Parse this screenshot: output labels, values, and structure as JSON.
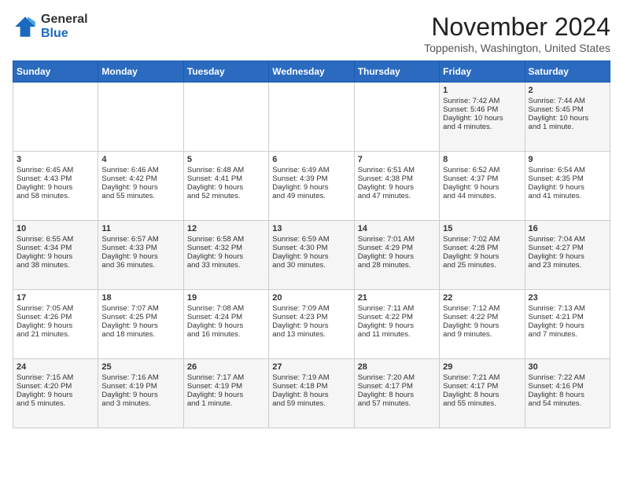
{
  "logo": {
    "general": "General",
    "blue": "Blue"
  },
  "title": "November 2024",
  "location": "Toppenish, Washington, United States",
  "days_of_week": [
    "Sunday",
    "Monday",
    "Tuesday",
    "Wednesday",
    "Thursday",
    "Friday",
    "Saturday"
  ],
  "weeks": [
    [
      {
        "day": "",
        "info": ""
      },
      {
        "day": "",
        "info": ""
      },
      {
        "day": "",
        "info": ""
      },
      {
        "day": "",
        "info": ""
      },
      {
        "day": "",
        "info": ""
      },
      {
        "day": "1",
        "info": "Sunrise: 7:42 AM\nSunset: 5:46 PM\nDaylight: 10 hours\nand 4 minutes."
      },
      {
        "day": "2",
        "info": "Sunrise: 7:44 AM\nSunset: 5:45 PM\nDaylight: 10 hours\nand 1 minute."
      }
    ],
    [
      {
        "day": "3",
        "info": "Sunrise: 6:45 AM\nSunset: 4:43 PM\nDaylight: 9 hours\nand 58 minutes."
      },
      {
        "day": "4",
        "info": "Sunrise: 6:46 AM\nSunset: 4:42 PM\nDaylight: 9 hours\nand 55 minutes."
      },
      {
        "day": "5",
        "info": "Sunrise: 6:48 AM\nSunset: 4:41 PM\nDaylight: 9 hours\nand 52 minutes."
      },
      {
        "day": "6",
        "info": "Sunrise: 6:49 AM\nSunset: 4:39 PM\nDaylight: 9 hours\nand 49 minutes."
      },
      {
        "day": "7",
        "info": "Sunrise: 6:51 AM\nSunset: 4:38 PM\nDaylight: 9 hours\nand 47 minutes."
      },
      {
        "day": "8",
        "info": "Sunrise: 6:52 AM\nSunset: 4:37 PM\nDaylight: 9 hours\nand 44 minutes."
      },
      {
        "day": "9",
        "info": "Sunrise: 6:54 AM\nSunset: 4:35 PM\nDaylight: 9 hours\nand 41 minutes."
      }
    ],
    [
      {
        "day": "10",
        "info": "Sunrise: 6:55 AM\nSunset: 4:34 PM\nDaylight: 9 hours\nand 38 minutes."
      },
      {
        "day": "11",
        "info": "Sunrise: 6:57 AM\nSunset: 4:33 PM\nDaylight: 9 hours\nand 36 minutes."
      },
      {
        "day": "12",
        "info": "Sunrise: 6:58 AM\nSunset: 4:32 PM\nDaylight: 9 hours\nand 33 minutes."
      },
      {
        "day": "13",
        "info": "Sunrise: 6:59 AM\nSunset: 4:30 PM\nDaylight: 9 hours\nand 30 minutes."
      },
      {
        "day": "14",
        "info": "Sunrise: 7:01 AM\nSunset: 4:29 PM\nDaylight: 9 hours\nand 28 minutes."
      },
      {
        "day": "15",
        "info": "Sunrise: 7:02 AM\nSunset: 4:28 PM\nDaylight: 9 hours\nand 25 minutes."
      },
      {
        "day": "16",
        "info": "Sunrise: 7:04 AM\nSunset: 4:27 PM\nDaylight: 9 hours\nand 23 minutes."
      }
    ],
    [
      {
        "day": "17",
        "info": "Sunrise: 7:05 AM\nSunset: 4:26 PM\nDaylight: 9 hours\nand 21 minutes."
      },
      {
        "day": "18",
        "info": "Sunrise: 7:07 AM\nSunset: 4:25 PM\nDaylight: 9 hours\nand 18 minutes."
      },
      {
        "day": "19",
        "info": "Sunrise: 7:08 AM\nSunset: 4:24 PM\nDaylight: 9 hours\nand 16 minutes."
      },
      {
        "day": "20",
        "info": "Sunrise: 7:09 AM\nSunset: 4:23 PM\nDaylight: 9 hours\nand 13 minutes."
      },
      {
        "day": "21",
        "info": "Sunrise: 7:11 AM\nSunset: 4:22 PM\nDaylight: 9 hours\nand 11 minutes."
      },
      {
        "day": "22",
        "info": "Sunrise: 7:12 AM\nSunset: 4:22 PM\nDaylight: 9 hours\nand 9 minutes."
      },
      {
        "day": "23",
        "info": "Sunrise: 7:13 AM\nSunset: 4:21 PM\nDaylight: 9 hours\nand 7 minutes."
      }
    ],
    [
      {
        "day": "24",
        "info": "Sunrise: 7:15 AM\nSunset: 4:20 PM\nDaylight: 9 hours\nand 5 minutes."
      },
      {
        "day": "25",
        "info": "Sunrise: 7:16 AM\nSunset: 4:19 PM\nDaylight: 9 hours\nand 3 minutes."
      },
      {
        "day": "26",
        "info": "Sunrise: 7:17 AM\nSunset: 4:19 PM\nDaylight: 9 hours\nand 1 minute."
      },
      {
        "day": "27",
        "info": "Sunrise: 7:19 AM\nSunset: 4:18 PM\nDaylight: 8 hours\nand 59 minutes."
      },
      {
        "day": "28",
        "info": "Sunrise: 7:20 AM\nSunset: 4:17 PM\nDaylight: 8 hours\nand 57 minutes."
      },
      {
        "day": "29",
        "info": "Sunrise: 7:21 AM\nSunset: 4:17 PM\nDaylight: 8 hours\nand 55 minutes."
      },
      {
        "day": "30",
        "info": "Sunrise: 7:22 AM\nSunset: 4:16 PM\nDaylight: 8 hours\nand 54 minutes."
      }
    ]
  ]
}
